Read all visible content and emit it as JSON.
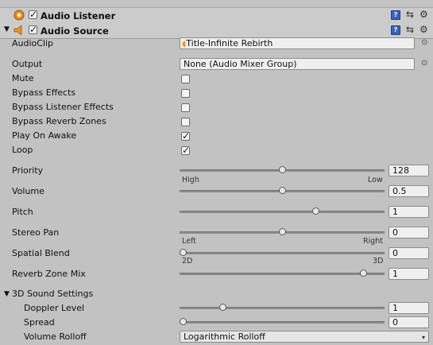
{
  "audio_listener": {
    "title": "Audio Listener"
  },
  "audio_source": {
    "title": "Audio Source",
    "audio_clip": {
      "label": "AudioClip",
      "value": "Title-Infinite Rebirth"
    },
    "output": {
      "label": "Output",
      "value": "None (Audio Mixer Group)"
    },
    "mute": {
      "label": "Mute",
      "checked": false
    },
    "bypass_effects": {
      "label": "Bypass Effects",
      "checked": false
    },
    "bypass_listener_effects": {
      "label": "Bypass Listener Effects",
      "checked": false
    },
    "bypass_reverb_zones": {
      "label": "Bypass Reverb Zones",
      "checked": false
    },
    "play_on_awake": {
      "label": "Play On Awake",
      "checked": true
    },
    "loop": {
      "label": "Loop",
      "checked": true
    },
    "priority": {
      "label": "Priority",
      "value": "128",
      "min_label": "High",
      "max_label": "Low",
      "fraction": 0.5
    },
    "volume": {
      "label": "Volume",
      "value": "0.5",
      "fraction": 0.5
    },
    "pitch": {
      "label": "Pitch",
      "value": "1",
      "fraction": 0.67
    },
    "stereo_pan": {
      "label": "Stereo Pan",
      "value": "0",
      "min_label": "Left",
      "max_label": "Right",
      "fraction": 0.5
    },
    "spatial_blend": {
      "label": "Spatial Blend",
      "value": "0",
      "min_label": "2D",
      "max_label": "3D",
      "fraction": 0.0
    },
    "reverb_zone_mix": {
      "label": "Reverb Zone Mix",
      "value": "1",
      "fraction": 0.91
    },
    "sound_3d": {
      "label": "3D Sound Settings",
      "doppler_level": {
        "label": "Doppler Level",
        "value": "1",
        "fraction": 0.2
      },
      "spread": {
        "label": "Spread",
        "value": "0",
        "fraction": 0.0
      },
      "volume_rolloff": {
        "label": "Volume Rolloff",
        "value": "Logarithmic Rolloff"
      }
    }
  },
  "icons": {
    "listener": "audio-listener-icon",
    "source": "speaker-icon",
    "help": "help-book-icon",
    "preset": "preset-icon",
    "settings": "gear-icon",
    "target": "object-picker-icon"
  }
}
